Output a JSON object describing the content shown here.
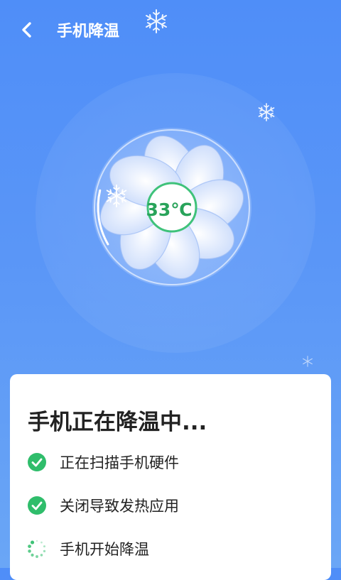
{
  "header": {
    "title": "手机降温",
    "back_icon": "chevron-left-icon"
  },
  "fan": {
    "temperature": "33℃",
    "progress": 0.2
  },
  "card": {
    "title": "手机正在降温中...",
    "steps": [
      {
        "label": "正在扫描手机硬件",
        "status": "done",
        "icon": "check-circle-icon"
      },
      {
        "label": "关闭导致发热应用",
        "status": "done",
        "icon": "check-circle-icon"
      },
      {
        "label": "手机开始降温",
        "status": "loading",
        "icon": "spinner-icon"
      }
    ]
  },
  "colors": {
    "background": "#5a96f7",
    "success": "#2fbd6b",
    "temp_text": "#29a35a"
  }
}
